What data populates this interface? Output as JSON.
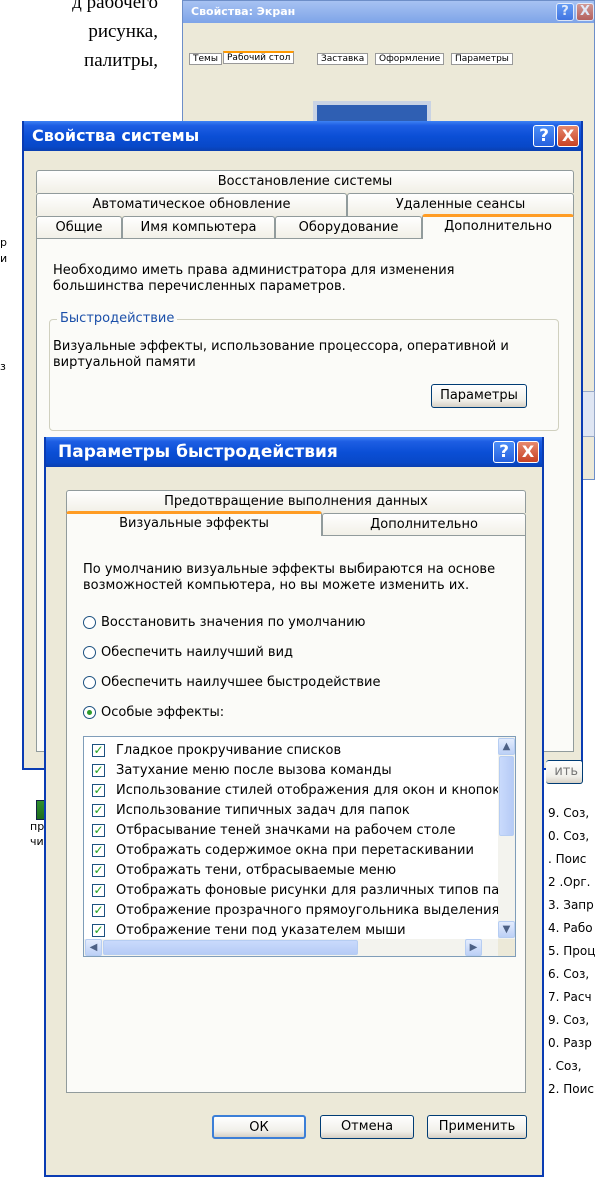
{
  "doc": {
    "lines": [
      "д рабочего",
      "рисунка,",
      "палитры,"
    ],
    "left_fragments": [
      "р",
      "и",
      "з"
    ],
    "bottom_left": {
      "line1": "про",
      "line2": "чис"
    },
    "right_list": [
      "9. Соз,",
      "0. Соз,",
      ". Поис",
      "2 .Орг.",
      "3. Запр",
      "4. Рабо",
      "5. Проц",
      "6. Соз,",
      "7. Расч",
      "9. Соз,",
      "0. Разр",
      ". Соз,",
      "2. Поис"
    ]
  },
  "screen_props": {
    "title": "Свойства: Экран",
    "tabs": [
      "Темы",
      "Рабочий стол",
      "Заставка",
      "Оформление",
      "Параметры"
    ],
    "help": "?",
    "close": "X",
    "partial_button": "ить"
  },
  "sys_props": {
    "title": "Свойства системы",
    "help": "?",
    "close": "X",
    "tabs_row1": [
      "Восстановление системы"
    ],
    "tabs_row2": [
      "Автоматическое обновление",
      "Удаленные сеансы"
    ],
    "tabs_row3": [
      "Общие",
      "Имя компьютера",
      "Оборудование",
      "Дополнительно"
    ],
    "admin_note": "Необходимо иметь права администратора для изменения большинства перечисленных параметров.",
    "perf_group": "Быстродействие",
    "perf_desc": "Визуальные эффекты, использование процессора, оперативной и виртуальной памяти",
    "params_button": "Параметры"
  },
  "perf_opts": {
    "title": "Параметры быстродействия",
    "help": "?",
    "close": "X",
    "tabs_row1": [
      "Предотвращение выполнения данных"
    ],
    "tabs_row2": [
      "Визуальные эффекты",
      "Дополнительно"
    ],
    "intro": "По умолчанию визуальные эффекты выбираются на основе возможностей компьютера, но вы можете изменить их.",
    "radios": [
      {
        "label": "Восстановить значения по умолчанию",
        "selected": false
      },
      {
        "label": "Обеспечить наилучший вид",
        "selected": false
      },
      {
        "label": "Обеспечить наилучшее быстродействие",
        "selected": false
      },
      {
        "label": "Особые эффекты:",
        "selected": true
      }
    ],
    "effects": [
      "Гладкое прокручивание списков",
      "Затухание меню после вызова команды",
      "Использование стилей отображения для окон и кнопок",
      "Использование типичных задач для папок",
      "Отбрасывание теней значками на рабочем столе",
      "Отображать содержимое окна при перетаскивании",
      "Отображать тени, отбрасываемые меню",
      "Отображать фоновые рисунки для различных типов папок",
      "Отображение прозрачного прямоугольника выделения",
      "Отображение тени под указателем мыши"
    ],
    "check_mark": "✓",
    "buttons": {
      "ok": "ОК",
      "cancel": "Отмена",
      "apply": "Применить"
    }
  }
}
